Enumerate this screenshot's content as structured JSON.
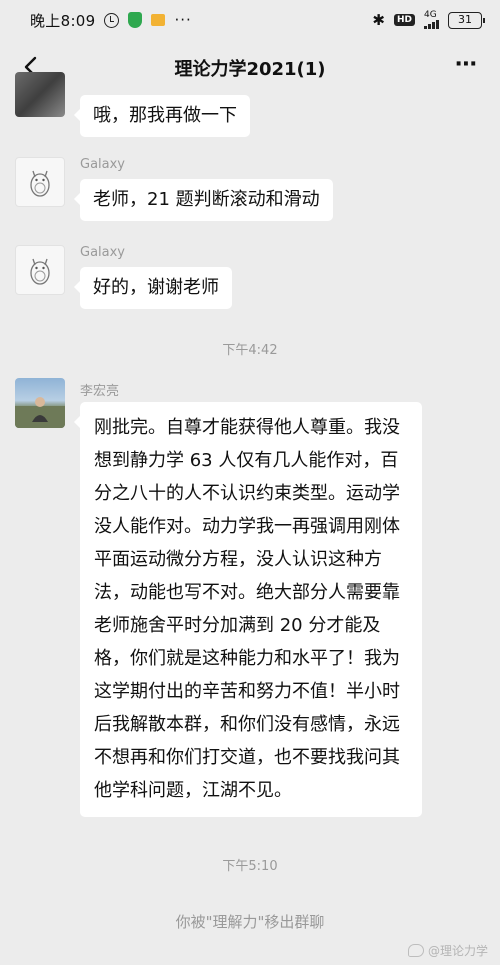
{
  "status": {
    "time": "晚上8:09",
    "dots": "···",
    "bluetooth": "✱",
    "hd": "HD",
    "network": "4G",
    "battery": "31"
  },
  "header": {
    "title": "理论力学2021(1)",
    "more": "⋯"
  },
  "messages": [
    {
      "sender": "",
      "text": "哦，那我再做一下"
    },
    {
      "sender": "Galaxy",
      "text": "老师，21 题判断滚动和滑动"
    },
    {
      "sender": "Galaxy",
      "text": "好的，谢谢老师"
    },
    {
      "timestamp": "下午4:42"
    },
    {
      "sender": "李宏亮",
      "text": "刚批完。自尊才能获得他人尊重。我没想到静力学 63 人仅有几人能作对，百分之八十的人不认识约束类型。运动学没人能作对。动力学我一再强调用刚体平面运动微分方程，没人认识这种方法，动能也写不对。绝大部分人需要靠老师施舍平时分加满到 20 分才能及格，你们就是这种能力和水平了！我为这学期付出的辛苦和努力不值！半小时后我解散本群，和你们没有感情，永远不想再和你们打交道，也不要找我问其他学科问题，江湖不见。"
    },
    {
      "timestamp": "下午5:10"
    }
  ],
  "system_notice": "你被\"理解力\"移出群聊",
  "watermark": "@理论力学"
}
